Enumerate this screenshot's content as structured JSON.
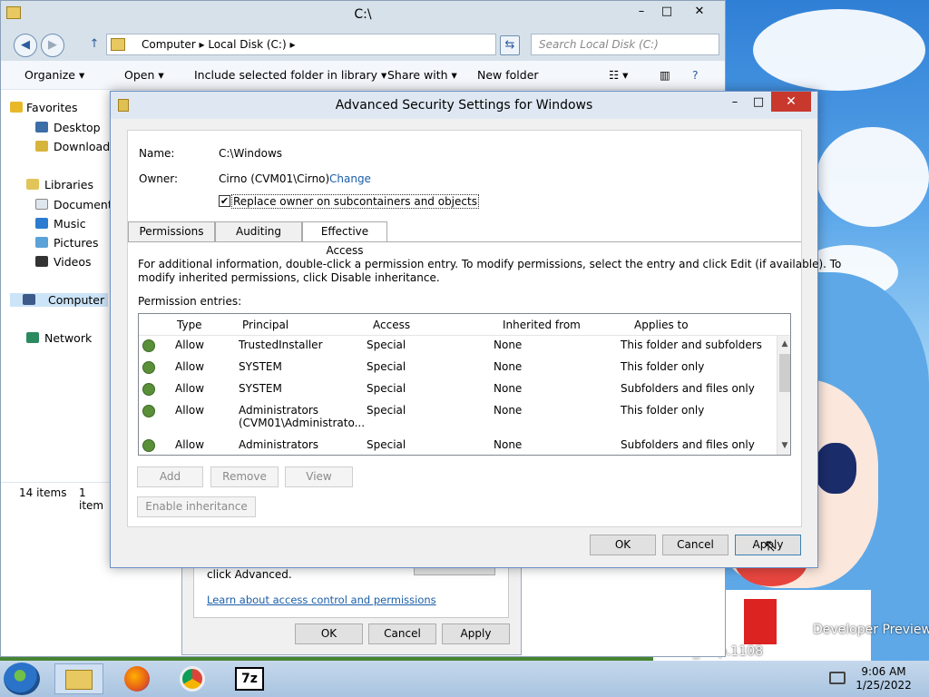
{
  "explorer": {
    "title": "C:\\",
    "address": [
      "Computer",
      "Local Disk (C:)"
    ],
    "search_placeholder": "Search Local Disk (C:)",
    "commands": [
      "Organize",
      "Open",
      "Include selected folder in library",
      "Share with",
      "New folder"
    ],
    "nav": {
      "favorites": "Favorites",
      "desktop": "Desktop",
      "downloads": "Downloads",
      "libraries": "Libraries",
      "documents": "Documents",
      "music": "Music",
      "pictures": "Pictures",
      "videos": "Videos",
      "computer": "Computer",
      "network": "Network"
    },
    "status": {
      "items": "14 items",
      "selected": "1 item"
    }
  },
  "props_window": {
    "advanced_text": "click Advanced.",
    "learn_link": "Learn about access control and permissions",
    "ok": "OK",
    "cancel": "Cancel",
    "apply": "Apply"
  },
  "dialog": {
    "title": "Advanced Security Settings for Windows",
    "name_label": "Name:",
    "name_value": "C:\\Windows",
    "owner_label": "Owner:",
    "owner_value": "Cirno (CVM01\\Cirno)",
    "change_link": "Change",
    "replace_owner_label": "Replace owner on subcontainers and objects",
    "tabs": [
      "Permissions",
      "Auditing",
      "Effective Access"
    ],
    "info_line1": "For additional information, double-click a permission entry. To modify permissions, select the entry and click Edit (if available). To",
    "info_line2": "modify inherited permissions, click Disable inheritance.",
    "entries_label": "Permission entries:",
    "columns": {
      "type": "Type",
      "principal": "Principal",
      "access": "Access",
      "inherited": "Inherited from",
      "applies": "Applies to"
    },
    "rows": [
      {
        "type": "Allow",
        "principal": "TrustedInstaller",
        "principal2": "",
        "access": "Special",
        "inherited": "None",
        "applies": "This folder and subfolders"
      },
      {
        "type": "Allow",
        "principal": "SYSTEM",
        "principal2": "",
        "access": "Special",
        "inherited": "None",
        "applies": "This folder only"
      },
      {
        "type": "Allow",
        "principal": "SYSTEM",
        "principal2": "",
        "access": "Special",
        "inherited": "None",
        "applies": "Subfolders and files only"
      },
      {
        "type": "Allow",
        "principal": "Administrators",
        "principal2": "(CVM01\\Administrato...",
        "access": "Special",
        "inherited": "None",
        "applies": "This folder only"
      },
      {
        "type": "Allow",
        "principal": "Administrators",
        "principal2": "",
        "access": "Special",
        "inherited": "None",
        "applies": "Subfolders and files only"
      }
    ],
    "buttons": {
      "add": "Add",
      "remove": "Remove",
      "view": "View",
      "enable_inheritance": "Enable inheritance",
      "ok": "OK",
      "cancel": "Cancel",
      "apply": "Apply"
    }
  },
  "taskbar": {
    "time": "9:06 AM",
    "date": "1/25/2022",
    "sevenzip_label": "7z"
  },
  "desktop": {
    "wm_dev": "Developer Preview",
    "wm_build": "64.fbl_leap.1108"
  }
}
